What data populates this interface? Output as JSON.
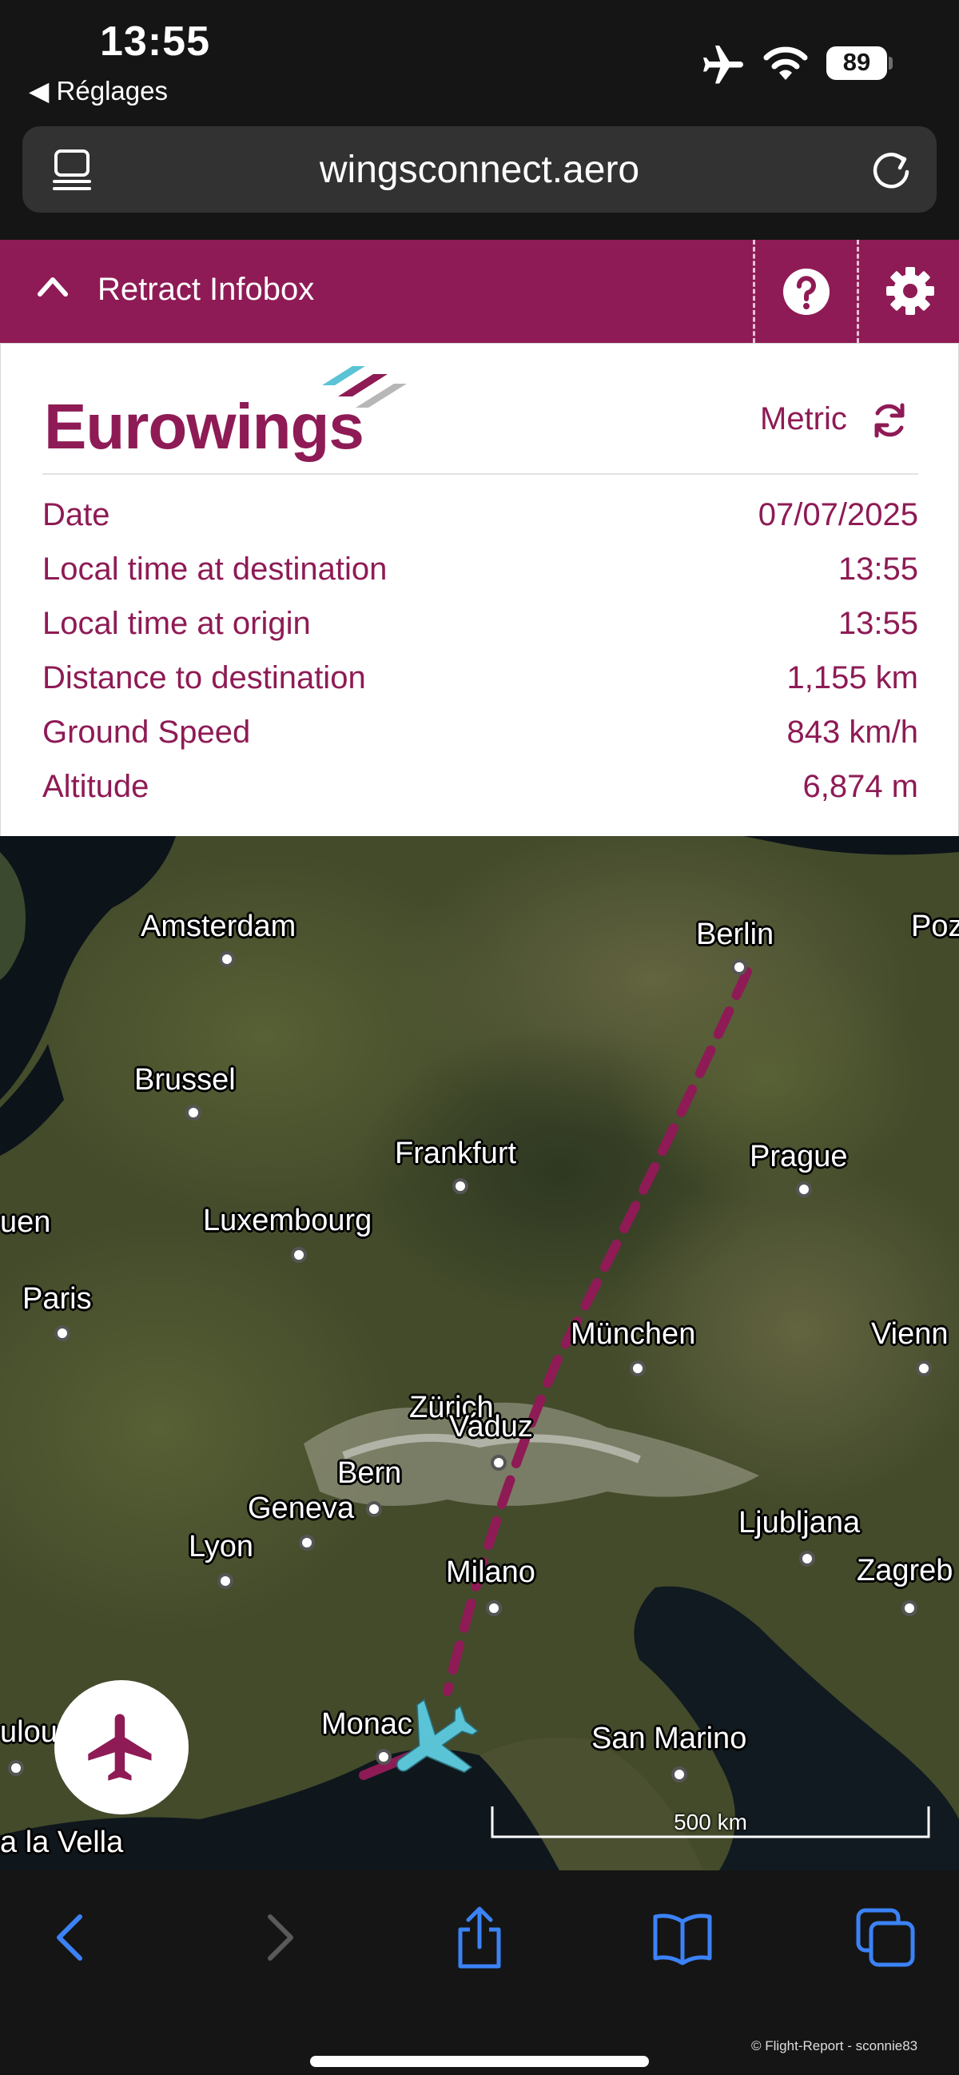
{
  "status_bar": {
    "time": "13:55",
    "back_label": "◀ Réglages",
    "battery": "89",
    "icons": [
      "airplane-mode-icon",
      "wifi-icon",
      "battery-icon"
    ]
  },
  "browser": {
    "url": "wingsconnect.aero",
    "icons": [
      "tab-overview-icon",
      "reload-icon"
    ]
  },
  "infobar": {
    "retract_label": "Retract Infobox",
    "icons": [
      "chevron-up-icon",
      "help-icon",
      "gear-icon"
    ]
  },
  "infobox": {
    "logo": "Eurowings",
    "units_label": "Metric",
    "rows": [
      {
        "label": "Date",
        "value": "07/07/2025"
      },
      {
        "label": "Local time at destination",
        "value": "13:55"
      },
      {
        "label": "Local time at origin",
        "value": "13:55"
      },
      {
        "label": "Distance to destination",
        "value": "1,155 km"
      },
      {
        "label": "Ground Speed",
        "value": "843 km/h"
      },
      {
        "label": "Altitude",
        "value": "6,874 m"
      }
    ],
    "colors": {
      "brand": "#8e1b55",
      "accent": "#5bc3d6"
    }
  },
  "map": {
    "cities": {
      "amsterdam": "Amsterdam",
      "berlin": "Berlin",
      "poz": "Poz",
      "brussel": "Brussel",
      "frankfurt": "Frankfurt",
      "prague": "Prague",
      "uen": "uen",
      "luxembourg": "Luxembourg",
      "paris": "Paris",
      "munchen": "München",
      "vienn": "Vienn",
      "zurich": "Zürich",
      "vaduz": "Vaduz",
      "bern": "Bern",
      "geneva": "Geneva",
      "lyon": "Lyon",
      "ljubljana": "Ljubljana",
      "milano": "Milano",
      "zagreb": "Zagreb",
      "monaco": "Monac",
      "san_marino": "San Marino",
      "toulouse": "ulous",
      "andorra": "a la Vella"
    },
    "scale_label": "500 km",
    "route_color": "#8e1b55",
    "aircraft_color": "#5bc3d6"
  },
  "toolbar": {
    "icons": [
      "back-arrow-icon",
      "forward-arrow-icon",
      "share-icon",
      "bookmarks-icon",
      "tabs-icon"
    ],
    "credit": "© Flight-Report - sconnie83"
  }
}
